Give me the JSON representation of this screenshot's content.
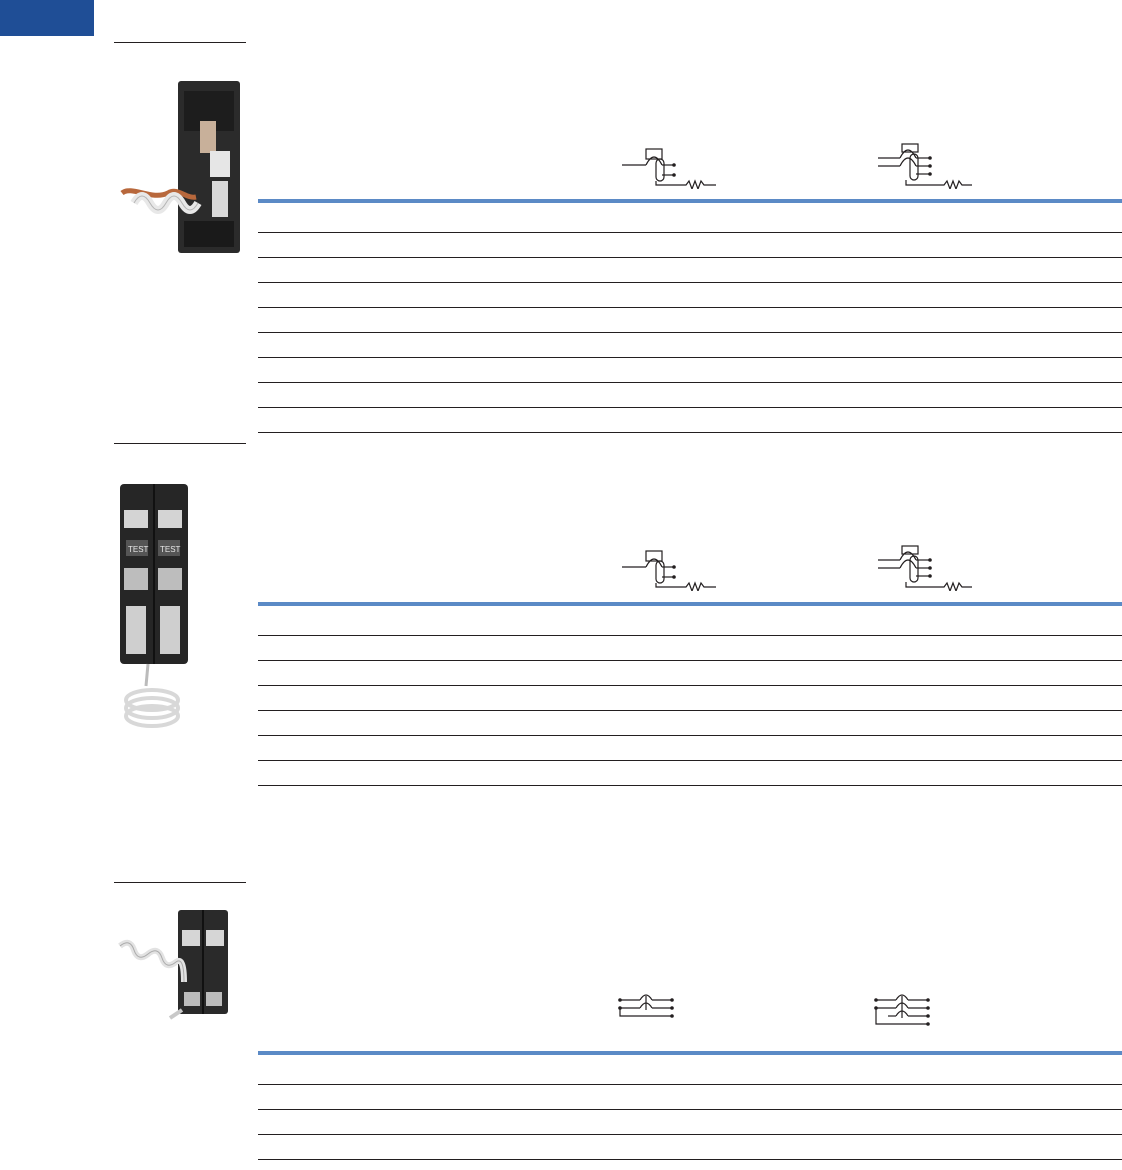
{
  "page": {
    "accent_color": "#1f4e96",
    "rule_color": "#5b8ac6",
    "line_color": "#231f20"
  },
  "sections": [
    {
      "product_icon": "single-pole-breaker-with-pigtail-photo",
      "diagram_icons": [
        "single-pole-trip-diagram",
        "two-pole-trip-diagram"
      ],
      "rows": [
        {},
        {},
        {},
        {},
        {},
        {},
        {},
        {},
        {}
      ]
    },
    {
      "product_icon": "two-pole-breaker-with-test-buttons-photo",
      "diagram_icons": [
        "single-pole-trip-diagram",
        "two-pole-trip-diagram"
      ],
      "rows": [
        {},
        {},
        {},
        {},
        {},
        {},
        {}
      ]
    },
    {
      "product_icon": "two-pole-breaker-with-coiled-lead-photo",
      "diagram_icons": [
        "two-wire-connection-diagram",
        "three-wire-connection-diagram"
      ],
      "rows": [
        {},
        {},
        {},
        {},
        {}
      ]
    }
  ]
}
